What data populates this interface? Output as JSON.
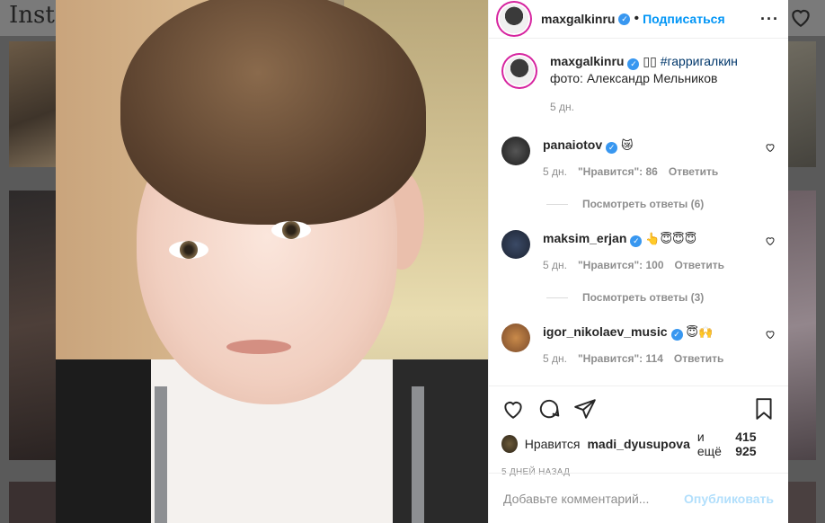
{
  "background": {
    "logo_text": "Insta"
  },
  "post": {
    "author": "maxgalkinru",
    "follow_label": "Подписаться",
    "caption_emoji": "▯▯",
    "caption_hashtag": "#гарригалкин",
    "caption_line2": "фото: Александр Мельников",
    "caption_age": "5 дн."
  },
  "comments": [
    {
      "user": "panaiotov",
      "text": "😿",
      "age": "5 дн.",
      "likes": "\"Нравится\": 86",
      "reply": "Ответить",
      "view_replies": "Посмотреть ответы (6)"
    },
    {
      "user": "maksim_erjan",
      "text": "👆😇😇😇",
      "age": "5 дн.",
      "likes": "\"Нравится\": 100",
      "reply": "Ответить",
      "view_replies": "Посмотреть ответы (3)"
    },
    {
      "user": "igor_nikolaev_music",
      "text": "😇🙌",
      "age": "5 дн.",
      "likes": "\"Нравится\": 114",
      "reply": "Ответить"
    }
  ],
  "likes": {
    "prefix": "Нравится",
    "user": "madi_dyusupova",
    "middle": "и ещё",
    "count": "415 925"
  },
  "date": "5 ДНЕЙ НАЗАД",
  "add_comment": {
    "placeholder": "Добавьте комментарий...",
    "publish_label": "Опубликовать"
  },
  "colors": {
    "accent": "#0095f6",
    "verified": "#3897f0",
    "publish_disabled": "#b2dffc"
  }
}
